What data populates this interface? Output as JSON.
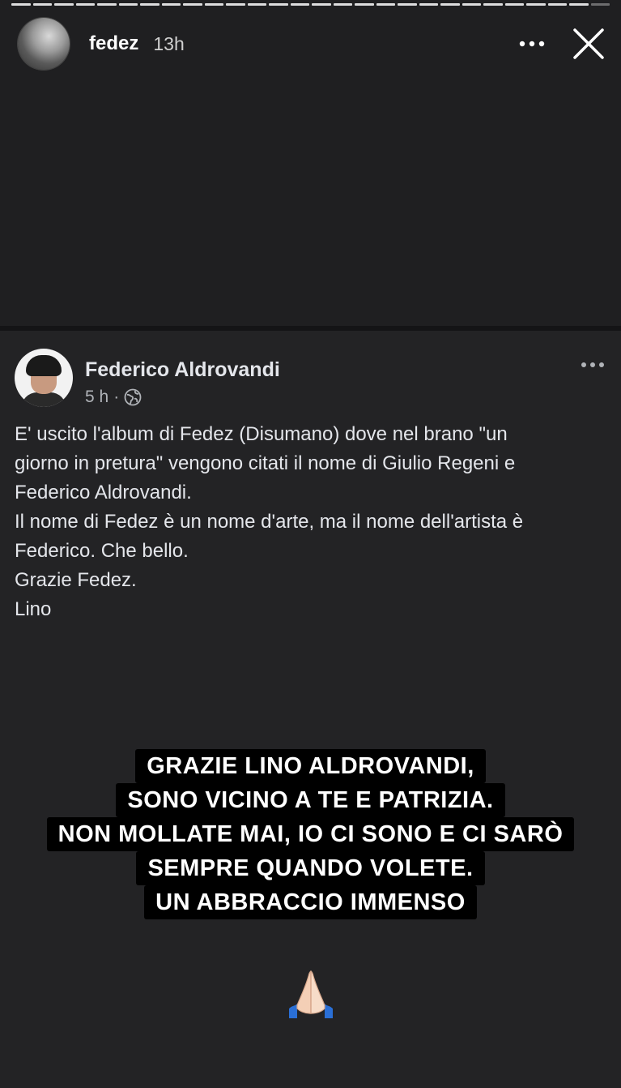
{
  "story": {
    "username": "fedez",
    "time": "13h",
    "segments": 28,
    "active_segment_index": 26
  },
  "post": {
    "author": "Federico Aldrovandi",
    "time": "5 h",
    "separator": "·",
    "audience_icon": "globe-icon",
    "text": "E' uscito l'album di Fedez (Disumano) dove nel brano \"un\ngiorno in pretura\"  vengono citati il nome di Giulio Regeni e\nFederico Aldrovandi.\nIl nome di Fedez è un nome d'arte, ma il nome dell'artista è\nFederico. Che bello.\nGrazie Fedez.\nLino"
  },
  "caption": {
    "lines": [
      "GRAZIE LINO ALDROVANDI,",
      "SONO VICINO A TE E PATRIZIA.",
      "NON MOLLATE MAI, IO CI SONO E CI SARÒ",
      "SEMPRE QUANDO VOLETE.",
      "UN ABBRACCIO IMMENSO"
    ]
  },
  "sticker": {
    "icon": "folded-hands-emoji"
  },
  "colors": {
    "background": "#1f1f21",
    "post_background": "#232325",
    "text": "#e4e6eb",
    "meta": "#b0b3b8",
    "caption_bg": "#000000"
  }
}
